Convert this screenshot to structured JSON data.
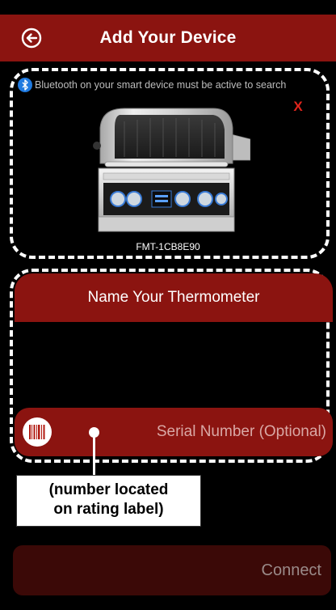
{
  "header": {
    "title": "Add Your Device",
    "back_icon": "back-circle-arrow-icon"
  },
  "device_card": {
    "bluetooth_notice": "Bluetooth on your smart device must be active to search",
    "bluetooth_icon": "bluetooth-icon",
    "close_label": "X",
    "device_name": "FMT-1CB8E90"
  },
  "name_card": {
    "banner_title": "Name Your Thermometer",
    "serial_placeholder": "Serial Number (Optional)",
    "barcode_icon": "barcode-icon"
  },
  "annotation": {
    "line1": "(number located",
    "line2": "on rating label)"
  },
  "footer": {
    "connect_label": "Connect"
  },
  "colors": {
    "header_bg": "#8b1410",
    "accent_red": "#e0241c",
    "bluetooth_blue": "#1f7ae0",
    "disabled_button": "#3b0907"
  }
}
